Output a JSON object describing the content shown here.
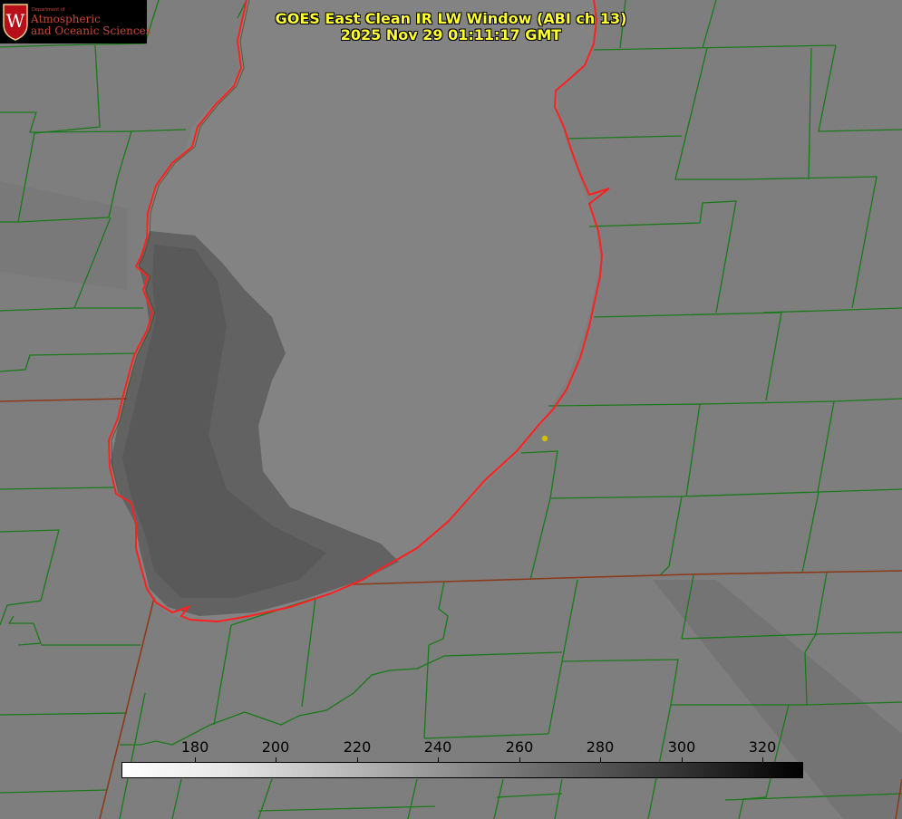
{
  "header": {
    "title": "GOES East Clean IR LW Window (ABI ch 13)",
    "timestamp": "2025 Nov 29 01:11:17 GMT"
  },
  "logo": {
    "department": "Department of",
    "line1": "Atmospheric",
    "line2": "and Oceanic Sciences",
    "seal_letter": "W"
  },
  "colorbar": {
    "ticks": [
      "180",
      "200",
      "220",
      "240",
      "260",
      "280",
      "300",
      "320"
    ]
  },
  "colors": {
    "title": "#ffff33",
    "county_lines": "#1a7a1a",
    "state_lines": "#8b3a1a",
    "coastline": "#ff2020",
    "marker": "#d4c000"
  },
  "icons": {
    "marker": "location-dot-icon",
    "logo": "uw-crest-icon"
  }
}
